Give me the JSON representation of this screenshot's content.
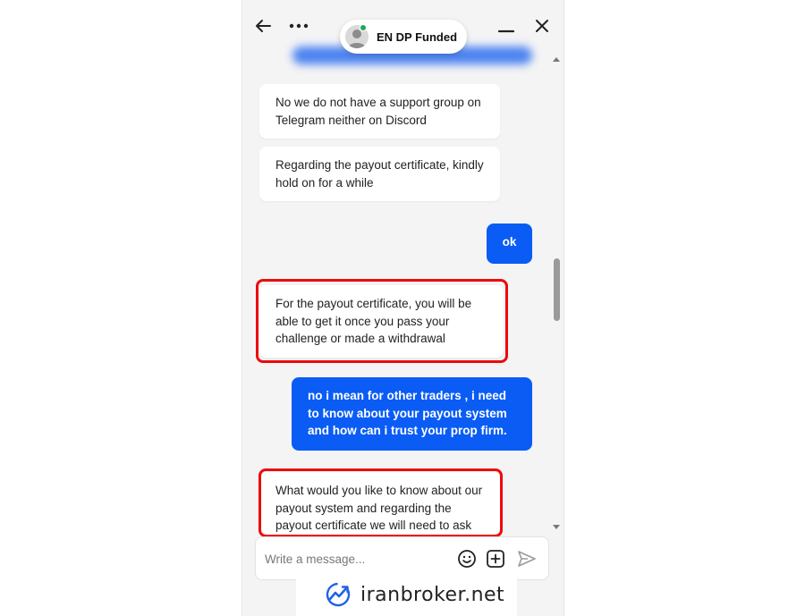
{
  "header": {
    "back_icon": "arrow-left-icon",
    "more_icon": "ellipsis-icon",
    "minimize_icon": "minimize-icon",
    "close_icon": "close-icon",
    "agent_name": "EN DP Funded",
    "status_color": "#1fa855"
  },
  "messages": [
    {
      "sender": "agent",
      "text": "No we do not have a support group on Telegram neither on Discord",
      "highlighted": false
    },
    {
      "sender": "agent",
      "text": "Regarding the payout certificate, kindly hold on for a while",
      "highlighted": false
    },
    {
      "sender": "user",
      "text": "ok"
    },
    {
      "sender": "agent",
      "text": "For the payout certificate, you will be able to get it once you pass your challenge or made a withdrawal",
      "highlighted": true
    },
    {
      "sender": "user",
      "text": "no i mean for other traders , i need to know about your payout system and how can i trust your prop firm."
    },
    {
      "sender": "agent",
      "text": "What would you like to know about our payout system and regarding the payout certificate we will need to ask",
      "highlighted": true
    }
  ],
  "composer": {
    "placeholder": "Write a message...",
    "emoji_icon": "smiley-icon",
    "attach_icon": "plus-square-icon",
    "send_icon": "send-icon"
  },
  "watermark": {
    "text": "iranbroker.net",
    "logo_icon": "trend-chart-logo"
  },
  "colors": {
    "user_bubble": "#0a5cf5",
    "agent_bubble": "#ffffff",
    "highlight_border": "#ee0a0a",
    "background": "#f4f4f5"
  }
}
